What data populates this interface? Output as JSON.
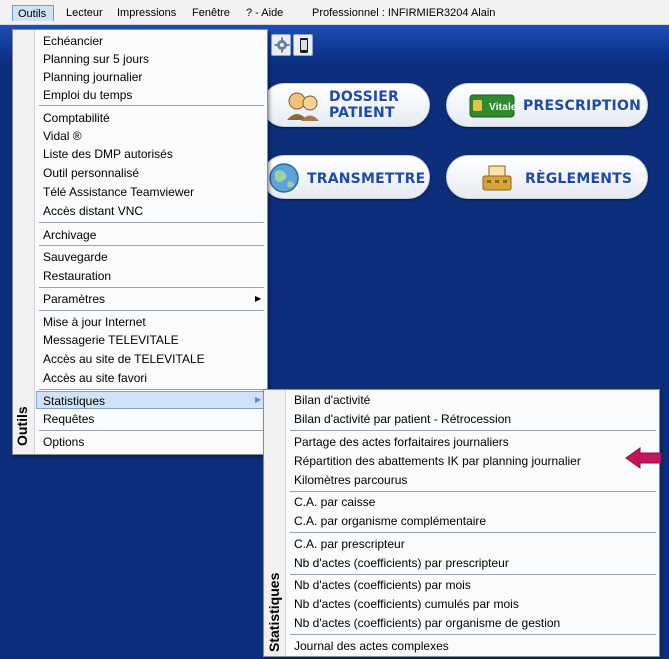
{
  "menubar": {
    "outils": "Outils",
    "lecteur": "Lecteur",
    "impressions": "Impressions",
    "fenetre": "Fenêtre",
    "aide": "? - Aide",
    "professionnel": "Professionnel : INFIRMIER3204 Alain"
  },
  "buttons": {
    "dossier": "DOSSIER PATIENT",
    "prescription": "PRESCRIPTION",
    "transmettre": "TRANSMETTRE",
    "reglements": "RÈGLEMENTS",
    "vitale_badge": "Vitale"
  },
  "outils_menu": {
    "side_label": "Outils",
    "items": [
      "Echéancier",
      "Planning sur 5 jours",
      "Planning journalier",
      "Emploi du temps",
      "Comptabilité",
      "Vidal ®",
      "Liste des DMP autorisés",
      "Outil personnalisé",
      "Télé Assistance Teamviewer",
      "Accès distant VNC",
      "Archivage",
      "Sauvegarde",
      "Restauration",
      "Paramètres",
      "Mise à jour Internet",
      "Messagerie TELEVITALE",
      "Accès au site de TELEVITALE",
      "Accès au site favori",
      "Statistiques",
      "Requêtes",
      "Options"
    ]
  },
  "stats_menu": {
    "side_label": "Statistiques",
    "items": [
      "Bilan d'activité",
      "Bilan d'activité par patient - Rétrocession",
      "Partage des actes forfaitaires journaliers",
      "Répartition des abattements IK par planning journalier",
      "Kilomètres parcourus",
      "C.A. par caisse",
      "C.A. par organisme complémentaire",
      "C.A. par prescripteur",
      "Nb d'actes (coefficients) par prescripteur",
      "Nb d'actes (coefficients) par mois",
      "Nb d'actes (coefficients) cumulés par mois",
      "Nb d'actes (coefficients) par organisme de gestion",
      "Journal des actes complexes"
    ]
  },
  "colors": {
    "app_background": "#0c2e7b",
    "button_text": "#1f4aa8",
    "selection": "#cfe2f8",
    "annotation_arrow": "#c2185b"
  }
}
